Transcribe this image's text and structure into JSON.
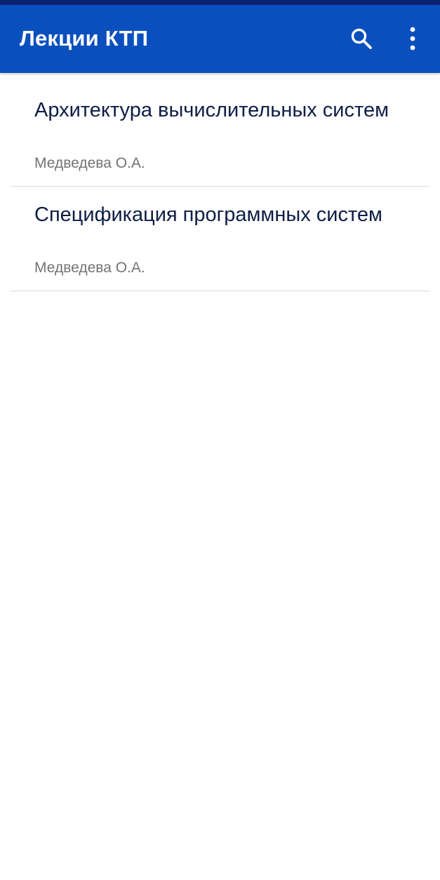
{
  "app_bar": {
    "title": "Лекции КТП",
    "actions": [
      {
        "icon": "search-icon"
      },
      {
        "icon": "more-vert-icon"
      }
    ],
    "color": "#0a4fbe"
  },
  "status_bar": {
    "color": "#0b2470"
  },
  "lectures": [
    {
      "title": "Архитектура вычислительных систем",
      "author": "Медведева О.А."
    },
    {
      "title": "Спецификация программных систем",
      "author": "Медведева О.А."
    }
  ],
  "colors": {
    "title_text": "#0f1e45",
    "subtitle_text": "#737373",
    "divider": "#dcdcdc"
  }
}
